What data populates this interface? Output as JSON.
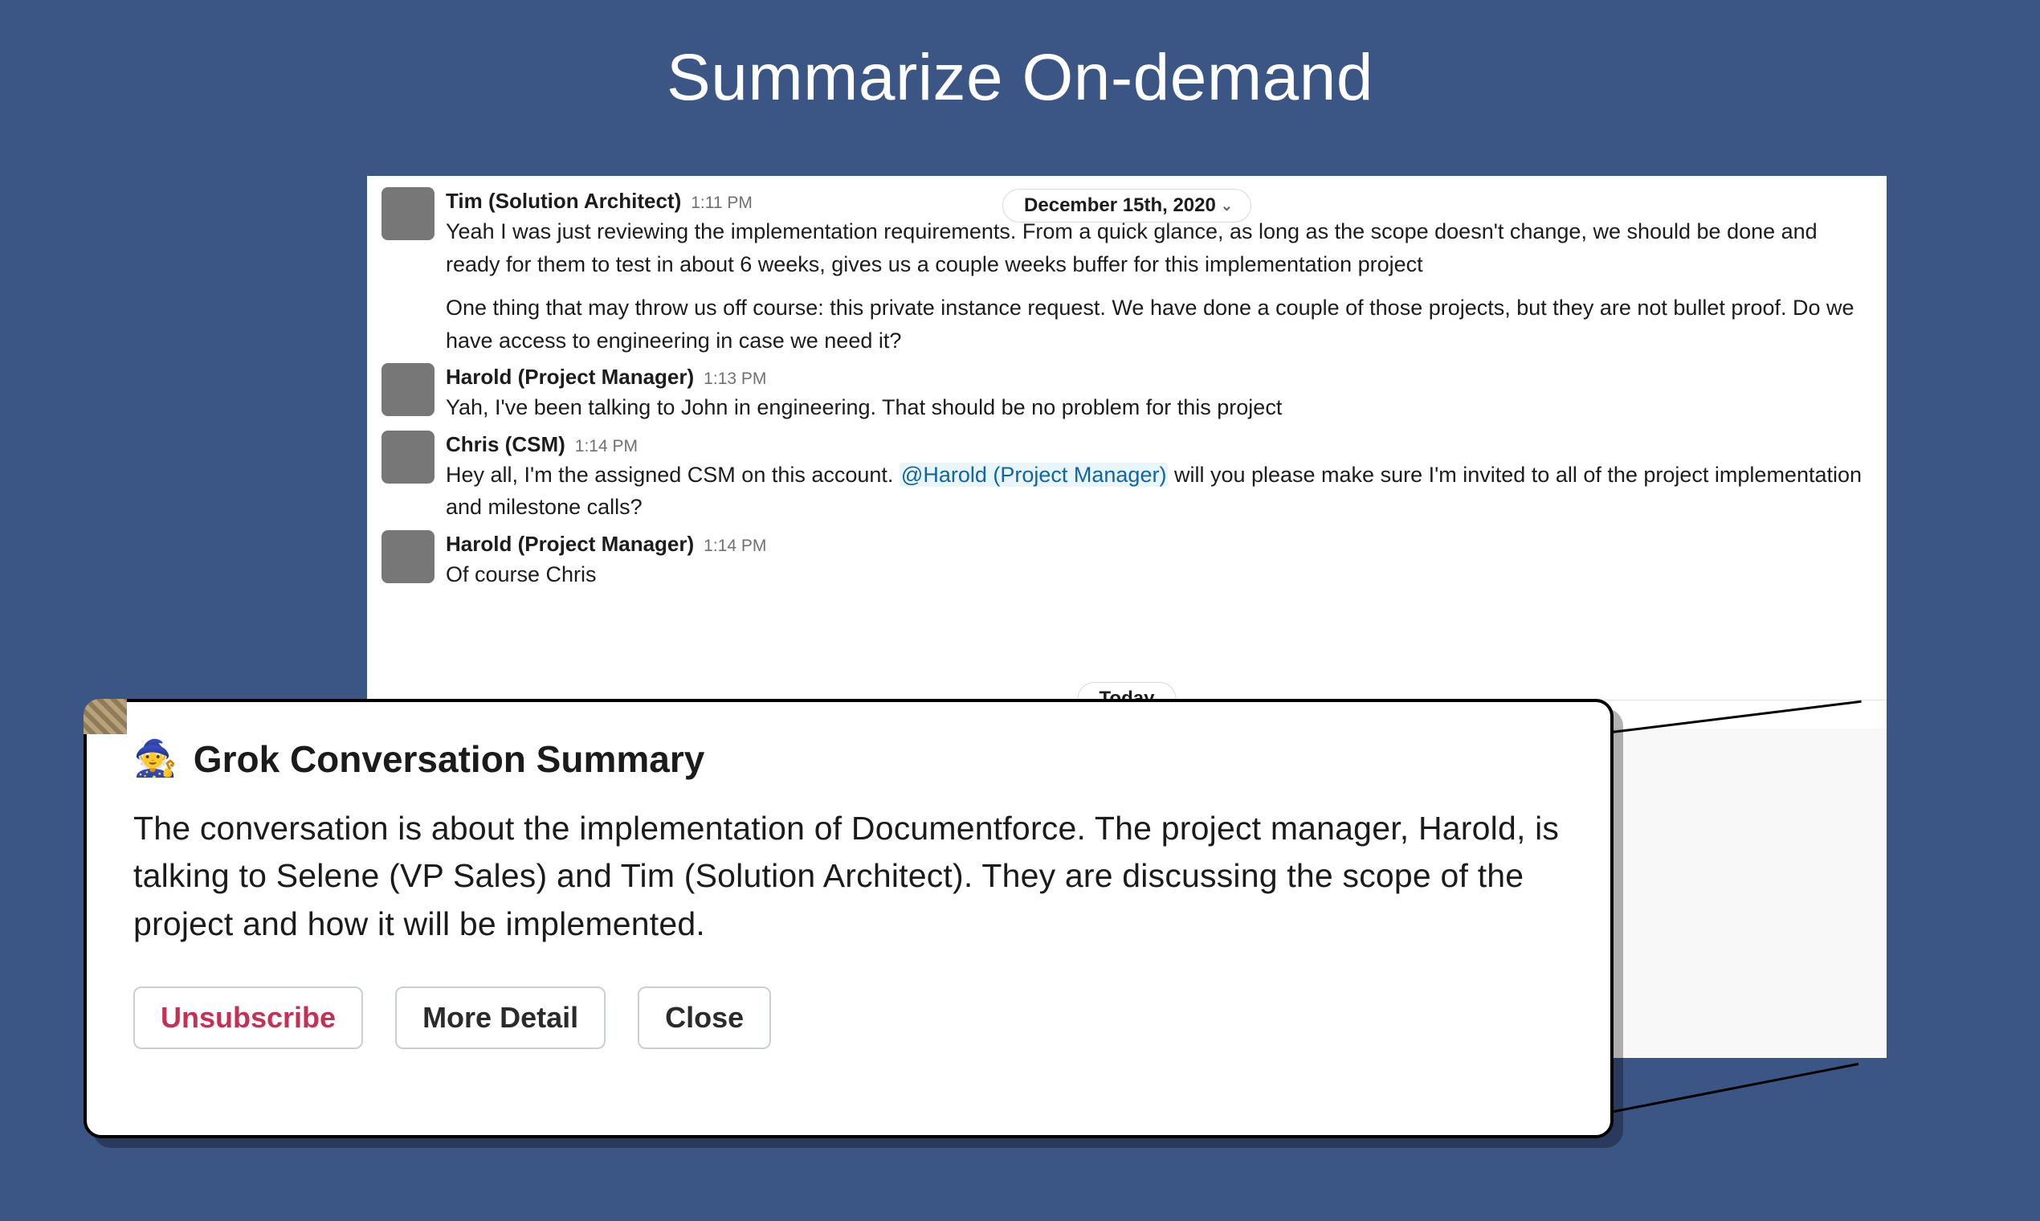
{
  "title": "Summarize On-demand",
  "date_label": "December 15th, 2020",
  "today_label": "Today",
  "messages": [
    {
      "name": "Tim (Solution Architect)",
      "time": "1:11 PM",
      "p1": "Yeah I was just reviewing the implementation requirements. From a quick glance, as long as the scope doesn't change, we should be done and ready for them to test in about 6 weeks, gives us a couple weeks buffer for this implementation project",
      "p2": "One thing that may throw us off course: this private instance request. We have done a couple of those projects, but they are not bullet proof. Do we have access to engineering in case we need it?"
    },
    {
      "name": "Harold (Project Manager)",
      "time": "1:13 PM",
      "p1": "Yah, I've been talking to John in engineering. That should be no problem for this project"
    },
    {
      "name": "Chris (CSM)",
      "time": "1:14 PM",
      "pre_mention": "Hey all, I'm the assigned CSM on this account. ",
      "mention": "@Harold (Project Manager)",
      "post_mention": " will you please make sure I'm invited to all of the project implementation and milestone calls?"
    },
    {
      "name": "Harold (Project Manager)",
      "time": "1:14 PM",
      "p1": "Of course Chris"
    }
  ],
  "summary": {
    "heading": "Grok Conversation Summary",
    "body": "The conversation is about the implementation of Documentforce. The project manager, Harold, is talking to Selene (VP Sales) and Tim (Solution Architect). They are discussing the scope of the project and how it will be implemented.",
    "buttons": {
      "unsubscribe": "Unsubscribe",
      "more": "More Detail",
      "close": "Close"
    }
  }
}
